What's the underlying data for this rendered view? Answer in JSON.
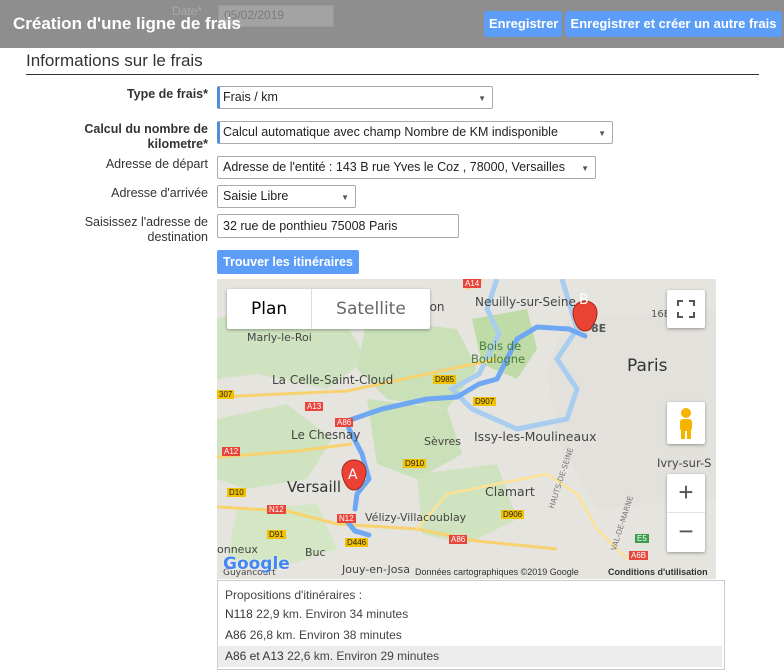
{
  "header": {
    "title": "Création d'une ligne de frais",
    "date_label": "Date*",
    "date_value": "05/02/2019",
    "save_label": "Enregistrer",
    "save_new_label": "Enregistrer et créer un autre frais"
  },
  "section": {
    "title": "Informations sur le frais"
  },
  "form": {
    "type_label": "Type de frais*",
    "type_value": "Frais / km",
    "calcul_label_1": "Calcul du nombre de",
    "calcul_label_2": "kilometre*",
    "calcul_value": "Calcul automatique avec champ Nombre de KM indisponible",
    "depart_label": "Adresse de départ",
    "depart_value": "Adresse de l'entité : 143 B rue Yves le Coz , 78000, Versailles",
    "arrivee_label": "Adresse d'arrivée",
    "arrivee_value": "Saisie Libre",
    "destination_label_1": "Saisissez l'adresse de",
    "destination_label_2": "destination",
    "destination_value": "32 rue de ponthieu 75008 Paris",
    "find_button": "Trouver les itinéraires"
  },
  "map": {
    "type_plan": "Plan",
    "type_satellite": "Satellite",
    "marker_a": "A",
    "marker_b": "B",
    "google": "Google",
    "attribution": "Données cartographiques ©2019 Google",
    "terms": "Conditions d'utilisation",
    "labels": {
      "neuilly": "Neuilly-sur-Seine",
      "paris": "Paris",
      "marly": "Marly-le-Roi",
      "bois1": "Bois de",
      "bois2": "Boulogne",
      "celle": "La Celle-Saint-Cloud",
      "chesnay": "Le Chesnay",
      "sevres": "Sèvres",
      "issy": "Issy-les-Moulineaux",
      "versailles": "Versaill",
      "clamart": "Clamart",
      "velizy": "Vélizy-Villacoublay",
      "buc": "Buc",
      "jouy": "Jouy-en-Josa",
      "ivry": "Ivry-sur-S",
      "guyancourt": "Guyancourt",
      "onneux": "onneux",
      "ison": "ison",
      "e8": "8E",
      "e16": "16E",
      "a14": "A14",
      "a13": "A13",
      "a12": "A12",
      "a86a": "A86",
      "a86b": "A86",
      "d985": "D985",
      "d907": "D907",
      "d910": "D910",
      "d906": "D906",
      "d446": "D446",
      "d91": "D91",
      "d10": "D10",
      "n12a": "N12",
      "n12b": "N12",
      "r307": "307",
      "a6b": "A6B",
      "e5": "E5",
      "hauts": "HAUTS-DE-SEINE",
      "valdemarne": "VAL-DE-MARNE"
    }
  },
  "proposals": {
    "title": "Propositions d'itinéraires :",
    "items": [
      {
        "road": "N118",
        "detail": "22,9 km. Environ 34 minutes"
      },
      {
        "road": "A86",
        "detail": "26,8 km. Environ 38 minutes"
      },
      {
        "road": "A86 et A13",
        "detail": "22,6 km. Environ 29 minutes"
      }
    ]
  }
}
